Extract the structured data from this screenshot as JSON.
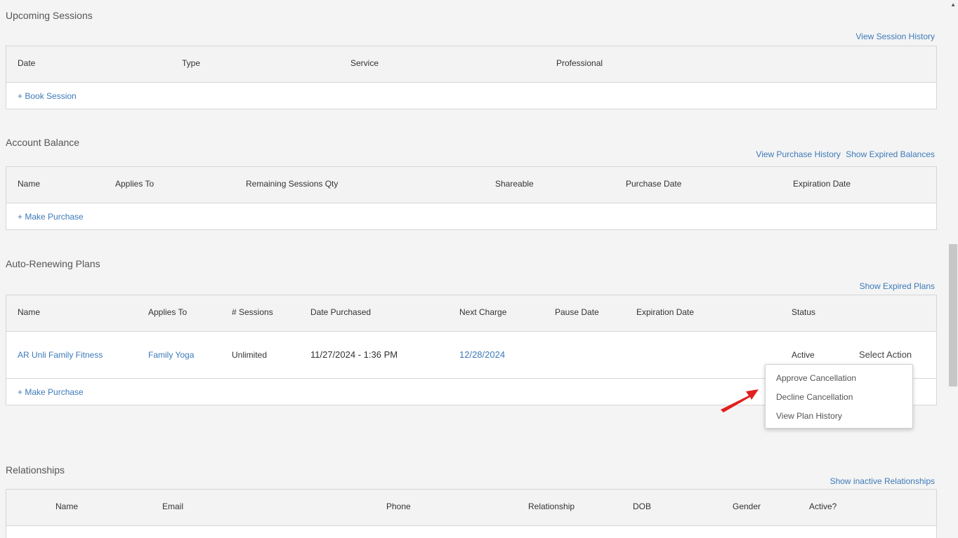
{
  "upcoming": {
    "title": "Upcoming Sessions",
    "history_link": "View Session History",
    "columns": [
      "Date",
      "Type",
      "Service",
      "Professional"
    ],
    "add_link": "+ Book Session"
  },
  "balance": {
    "title": "Account Balance",
    "links": [
      "View Purchase History",
      "Show Expired Balances"
    ],
    "columns": [
      "Name",
      "Applies To",
      "Remaining Sessions Qty",
      "Shareable",
      "Purchase Date",
      "Expiration Date"
    ],
    "add_link": "+ Make Purchase"
  },
  "plans": {
    "title": "Auto-Renewing Plans",
    "link": "Show Expired Plans",
    "columns": [
      "Name",
      "Applies To",
      "# Sessions",
      "Date Purchased",
      "Next Charge",
      "Pause Date",
      "Expiration Date",
      "Status"
    ],
    "row": {
      "name": "AR Unli Family Fitness",
      "applies_to": "Family Yoga",
      "sessions": "Unlimited",
      "date_purchased": "11/27/2024 - 1:36 PM",
      "next_charge": "12/28/2024",
      "status": "Active",
      "action": "Select Action"
    },
    "add_link": "+ Make Purchase"
  },
  "action_menu": {
    "items": [
      "Approve Cancellation",
      "Decline Cancellation",
      "View Plan History"
    ]
  },
  "relationships": {
    "title": "Relationships",
    "link": "Show inactive Relationships",
    "columns": [
      "Name",
      "Email",
      "Phone",
      "Relationship",
      "DOB",
      "Gender",
      "Active?"
    ]
  },
  "colors": {
    "link": "#3d7ab8",
    "arrow": "#e02020",
    "header_bg": "#f3f3f3"
  }
}
